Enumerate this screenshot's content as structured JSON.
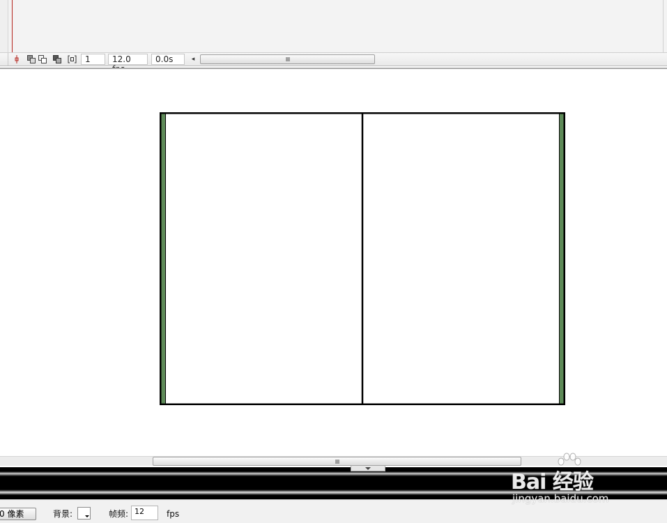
{
  "timeline": {
    "current_frame": "1",
    "frame_rate": "12.0 fps",
    "elapsed_time": "0.0s",
    "toolbar_icons": [
      "center-frame-icon",
      "onion-skin-icon",
      "onion-skin-outlines-icon",
      "edit-multiple-frames-icon",
      "modify-onion-markers-icon"
    ],
    "scroll_left_glyph": "◂",
    "playhead_color": "#b5261e"
  },
  "stage": {
    "background": "#ffffff",
    "book": {
      "border_color": "#000000",
      "spine_color": "#5e8a58",
      "page_color": "#ffffff"
    }
  },
  "properties": {
    "size_button": "0 像素",
    "background_label": "背景:",
    "background_color": "#ffffff",
    "frame_rate_label": "帧频:",
    "frame_rate_value": "12",
    "fps_unit": "fps"
  },
  "watermark": {
    "logo_text": "Bai 经验",
    "url": "jingyan.baidu.com"
  }
}
